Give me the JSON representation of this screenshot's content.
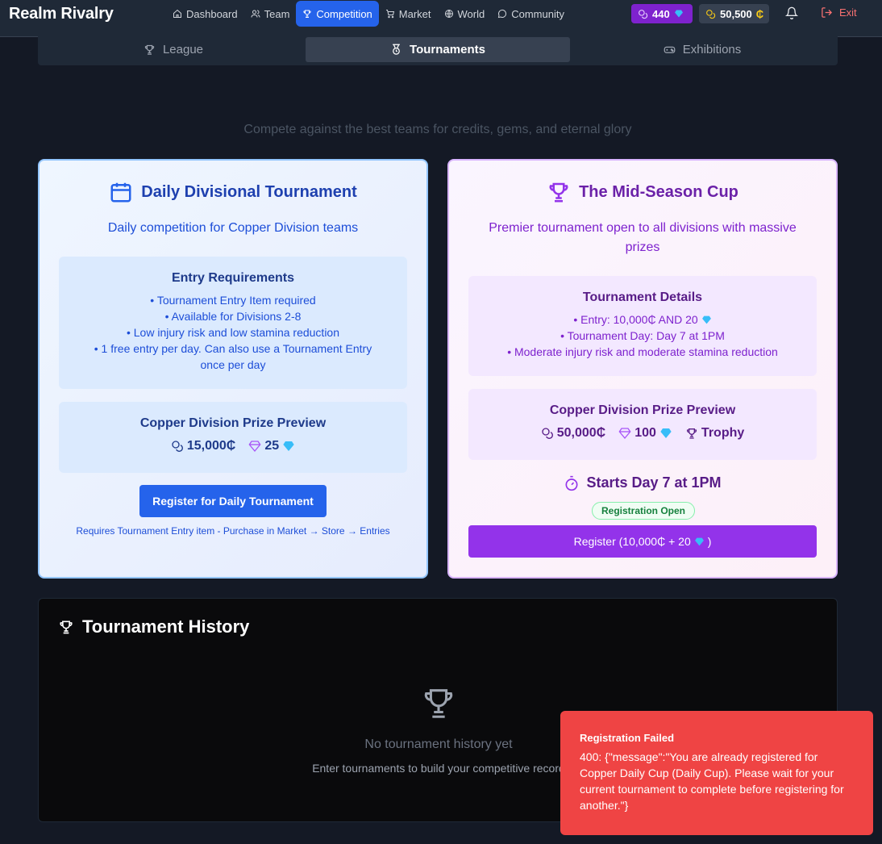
{
  "app": {
    "title": "Realm Rivalry"
  },
  "nav": {
    "items": [
      {
        "label": "Dashboard",
        "icon": "home-icon",
        "active": false
      },
      {
        "label": "Team",
        "icon": "users-icon",
        "active": false
      },
      {
        "label": "Competition",
        "icon": "trophy-icon",
        "active": true
      },
      {
        "label": "Market",
        "icon": "cart-icon",
        "active": false
      },
      {
        "label": "World",
        "icon": "globe-icon",
        "active": false
      },
      {
        "label": "Community",
        "icon": "chat-icon",
        "active": false
      }
    ],
    "gems": "440",
    "credits": "50,500",
    "exit_label": "Exit"
  },
  "tabs": [
    {
      "label": "League",
      "icon": "trophy-icon",
      "active": false
    },
    {
      "label": "Tournaments",
      "icon": "medal-icon",
      "active": true
    },
    {
      "label": "Exhibitions",
      "icon": "gamepad-icon",
      "active": false
    }
  ],
  "subtitle": "Compete against the best teams for credits, gems, and eternal glory",
  "daily": {
    "title": "Daily Divisional Tournament",
    "description": "Daily competition for Copper Division teams",
    "requirements_title": "Entry Requirements",
    "requirements": [
      "• Tournament Entry Item required",
      "• Available for Divisions 2-8",
      "• Low injury risk and low stamina reduction",
      "• 1 free entry per day. Can also use a Tournament Entry once per day"
    ],
    "prize_title": "Copper Division Prize Preview",
    "prize_credits": "15,000₵",
    "prize_gems": "25",
    "register_label": "Register for Daily Tournament",
    "requires_note": "Requires Tournament Entry item - Purchase in Market → Store → Entries"
  },
  "mid": {
    "title": "The Mid-Season Cup",
    "description": "Premier tournament open to all divisions with massive prizes",
    "details_title": "Tournament Details",
    "details": [
      "• Entry: 10,000₵ AND 20",
      "• Tournament Day: Day 7 at 1PM",
      "• Moderate injury risk and moderate stamina reduction"
    ],
    "prize_title": "Copper Division Prize Preview",
    "prize_credits": "50,000₵",
    "prize_gems": "100",
    "prize_trophy": "Trophy",
    "starts": "Starts Day 7 at 1PM",
    "status_badge": "Registration Open",
    "register_label": "Register (10,000₵ + 20",
    "register_suffix": ")"
  },
  "history": {
    "title": "Tournament History",
    "empty_title": "No tournament history yet",
    "empty_sub": "Enter tournaments to build your competitive record"
  },
  "toast": {
    "title": "Registration Failed",
    "message": "400: {\"message\":\"You are already registered for Copper Daily Cup (Daily Cup). Please wait for your current tournament to complete before registering for another.\"}"
  },
  "colors": {
    "accent_blue": "#2563eb",
    "accent_purple": "#9333ea",
    "gem_pill": "#7e22ce",
    "error": "#ef4444",
    "gem": "#38bdf8",
    "credit": "#facc15"
  }
}
